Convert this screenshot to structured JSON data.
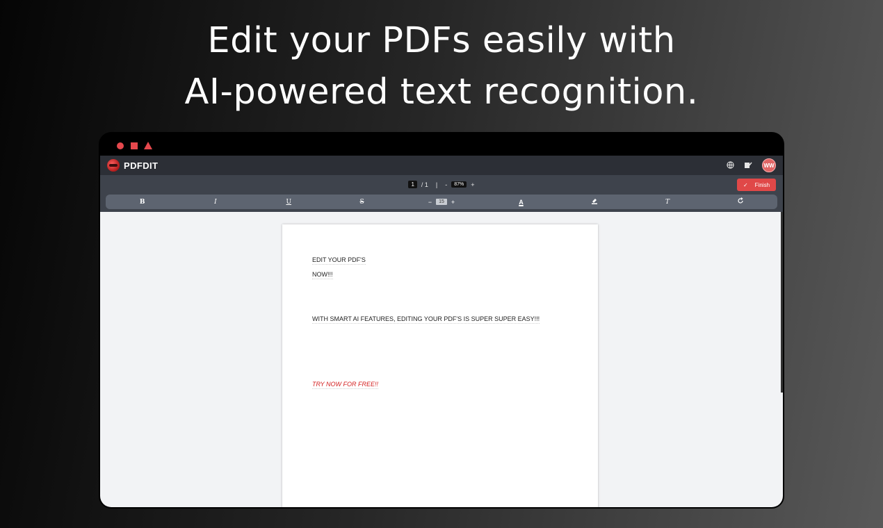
{
  "headline": {
    "line1": "Edit your PDFs easily with",
    "line2": "AI-powered text recognition."
  },
  "app": {
    "brand": "PDFDIT",
    "avatar_initials": "WW",
    "colors": {
      "accent": "#e04848",
      "appbar": "#2c2f36",
      "toolbar": "#3e434c",
      "formatbar": "#5d6470"
    },
    "icons": {
      "globe": "globe-icon",
      "signature": "signature-icon"
    }
  },
  "pager": {
    "current_page": "1",
    "total": "/ 1",
    "divider": "|",
    "zoom_out": "-",
    "zoom": "87%",
    "zoom_in": "+"
  },
  "finish_button": {
    "icon": "✓",
    "label": "Finish"
  },
  "format": {
    "bold": "B",
    "italic": "I",
    "underline": "U",
    "strike": "S",
    "size_minus": "−",
    "font_size": "15",
    "size_plus": "+",
    "text_color": "A",
    "highlight": "highlight-icon",
    "clear_format": "T",
    "rotate": "rotate-icon"
  },
  "document": {
    "lines": [
      {
        "text": "EDIT YOUR PDF'S"
      },
      {
        "text": "NOW!!!"
      },
      {
        "text": "WITH SMART AI FEATURES, EDITING YOUR PDF'S IS SUPER SUPER EASY!!!"
      },
      {
        "text": "TRY NOW FOR FREE!!",
        "color": "#d42020"
      }
    ]
  }
}
